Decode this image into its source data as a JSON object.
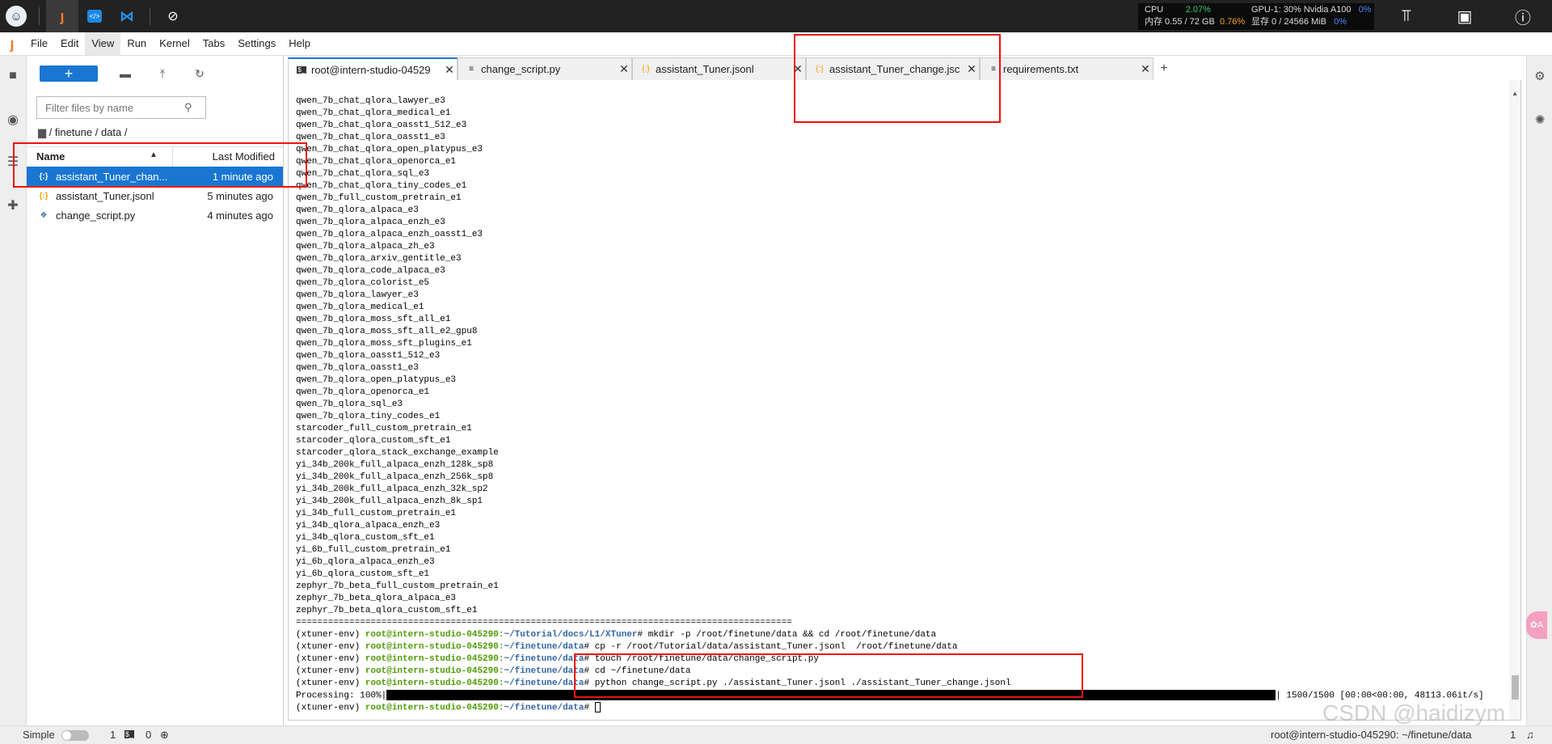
{
  "topbar": {
    "apps": [
      "intern-studio-logo-icon",
      "jupyter-icon",
      "vscode-alt-icon",
      "vscode-icon",
      "compass-icon"
    ],
    "stats": {
      "cpu_label": "CPU",
      "cpu_value": "2.07%",
      "mem_label": "内存 0.55 / 72 GB",
      "mem_value": "0.76%",
      "gpu_label": "GPU-1: 30% Nvidia A100",
      "gpu_value": "0%",
      "vram_label": "显存 0 / 24566 MiB",
      "vram_value": "0%"
    }
  },
  "menubar": {
    "items": [
      "File",
      "Edit",
      "View",
      "Run",
      "Kernel",
      "Tabs",
      "Settings",
      "Help"
    ],
    "active": "View"
  },
  "filebrowser": {
    "new_label": "+",
    "filter_placeholder": "Filter files by name",
    "breadcrumb": "/ finetune / data /",
    "col_name": "Name",
    "col_modified": "Last Modified",
    "files": [
      {
        "name": "assistant_Tuner_chan...",
        "modified": "1 minute ago",
        "icon": "{:}",
        "selected": true
      },
      {
        "name": "assistant_Tuner.jsonl",
        "modified": "5 minutes ago",
        "icon": "{:}",
        "selected": false
      },
      {
        "name": "change_script.py",
        "modified": "4 minutes ago",
        "icon": "py",
        "selected": false
      }
    ]
  },
  "tabs": [
    {
      "label": "root@intern-studio-04529",
      "icon": "$_",
      "active": true
    },
    {
      "label": "change_script.py",
      "icon": "≡",
      "active": false
    },
    {
      "label": "assistant_Tuner.jsonl",
      "icon": "{:}",
      "active": false
    },
    {
      "label": "assistant_Tuner_change.jsc",
      "icon": "{:}",
      "active": false
    },
    {
      "label": "requirements.txt",
      "icon": "≡",
      "active": false
    }
  ],
  "terminal": {
    "config_lines": [
      "qwen_7b_chat_qlora_lawyer_e3",
      "qwen_7b_chat_qlora_medical_e1",
      "qwen_7b_chat_qlora_oasst1_512_e3",
      "qwen_7b_chat_qlora_oasst1_e3",
      "qwen_7b_chat_qlora_open_platypus_e3",
      "qwen_7b_chat_qlora_openorca_e1",
      "qwen_7b_chat_qlora_sql_e3",
      "qwen_7b_chat_qlora_tiny_codes_e1",
      "qwen_7b_full_custom_pretrain_e1",
      "qwen_7b_qlora_alpaca_e3",
      "qwen_7b_qlora_alpaca_enzh_e3",
      "qwen_7b_qlora_alpaca_enzh_oasst1_e3",
      "qwen_7b_qlora_alpaca_zh_e3",
      "qwen_7b_qlora_arxiv_gentitle_e3",
      "qwen_7b_qlora_code_alpaca_e3",
      "qwen_7b_qlora_colorist_e5",
      "qwen_7b_qlora_lawyer_e3",
      "qwen_7b_qlora_medical_e1",
      "qwen_7b_qlora_moss_sft_all_e1",
      "qwen_7b_qlora_moss_sft_all_e2_gpu8",
      "qwen_7b_qlora_moss_sft_plugins_e1",
      "qwen_7b_qlora_oasst1_512_e3",
      "qwen_7b_qlora_oasst1_e3",
      "qwen_7b_qlora_open_platypus_e3",
      "qwen_7b_qlora_openorca_e1",
      "qwen_7b_qlora_sql_e3",
      "qwen_7b_qlora_tiny_codes_e1",
      "starcoder_full_custom_pretrain_e1",
      "starcoder_qlora_custom_sft_e1",
      "starcoder_qlora_stack_exchange_example",
      "yi_34b_200k_full_alpaca_enzh_128k_sp8",
      "yi_34b_200k_full_alpaca_enzh_256k_sp8",
      "yi_34b_200k_full_alpaca_enzh_32k_sp2",
      "yi_34b_200k_full_alpaca_enzh_8k_sp1",
      "yi_34b_full_custom_pretrain_e1",
      "yi_34b_qlora_alpaca_enzh_e3",
      "yi_34b_qlora_custom_sft_e1",
      "yi_6b_full_custom_pretrain_e1",
      "yi_6b_qlora_alpaca_enzh_e3",
      "yi_6b_qlora_custom_sft_e1",
      "zephyr_7b_beta_full_custom_pretrain_e1",
      "zephyr_7b_beta_qlora_alpaca_e3",
      "zephyr_7b_beta_qlora_custom_sft_e1"
    ],
    "separator": "=============================================================================================",
    "env": "(xtuner-env)",
    "prompt_user": "root@intern-studio-045290:",
    "commands": [
      {
        "path": "~/Tutorial/docs/L1/XTuner",
        "cmd": "# mkdir -p /root/finetune/data && cd /root/finetune/data"
      },
      {
        "path": "~/finetune/data",
        "cmd": "# cp -r /root/Tutorial/data/assistant_Tuner.jsonl  /root/finetune/data"
      },
      {
        "path": "~/finetune/data",
        "cmd": "# touch /root/finetune/data/change_script.py"
      },
      {
        "path": "~/finetune/data",
        "cmd": "# cd ~/finetune/data"
      },
      {
        "path": "~/finetune/data",
        "cmd": "# python change_script.py ./assistant_Tuner.jsonl ./assistant_Tuner_change.jsonl"
      }
    ],
    "progress_label": "Processing: 100%|",
    "progress_fraction": 1.0,
    "progress_stats": "| 1500/1500 [00:00<00:00, 48113.06it/s]",
    "last_prompt_path": "~/finetune/data",
    "last_prompt_cmd": "# "
  },
  "statusbar": {
    "mode": "Simple",
    "count1": "1",
    "count2": "0",
    "right_text": "root@intern-studio-045290: ~/finetune/data",
    "right_num": "1"
  },
  "watermark": "CSDN @haidizym",
  "float_label": "✿A"
}
